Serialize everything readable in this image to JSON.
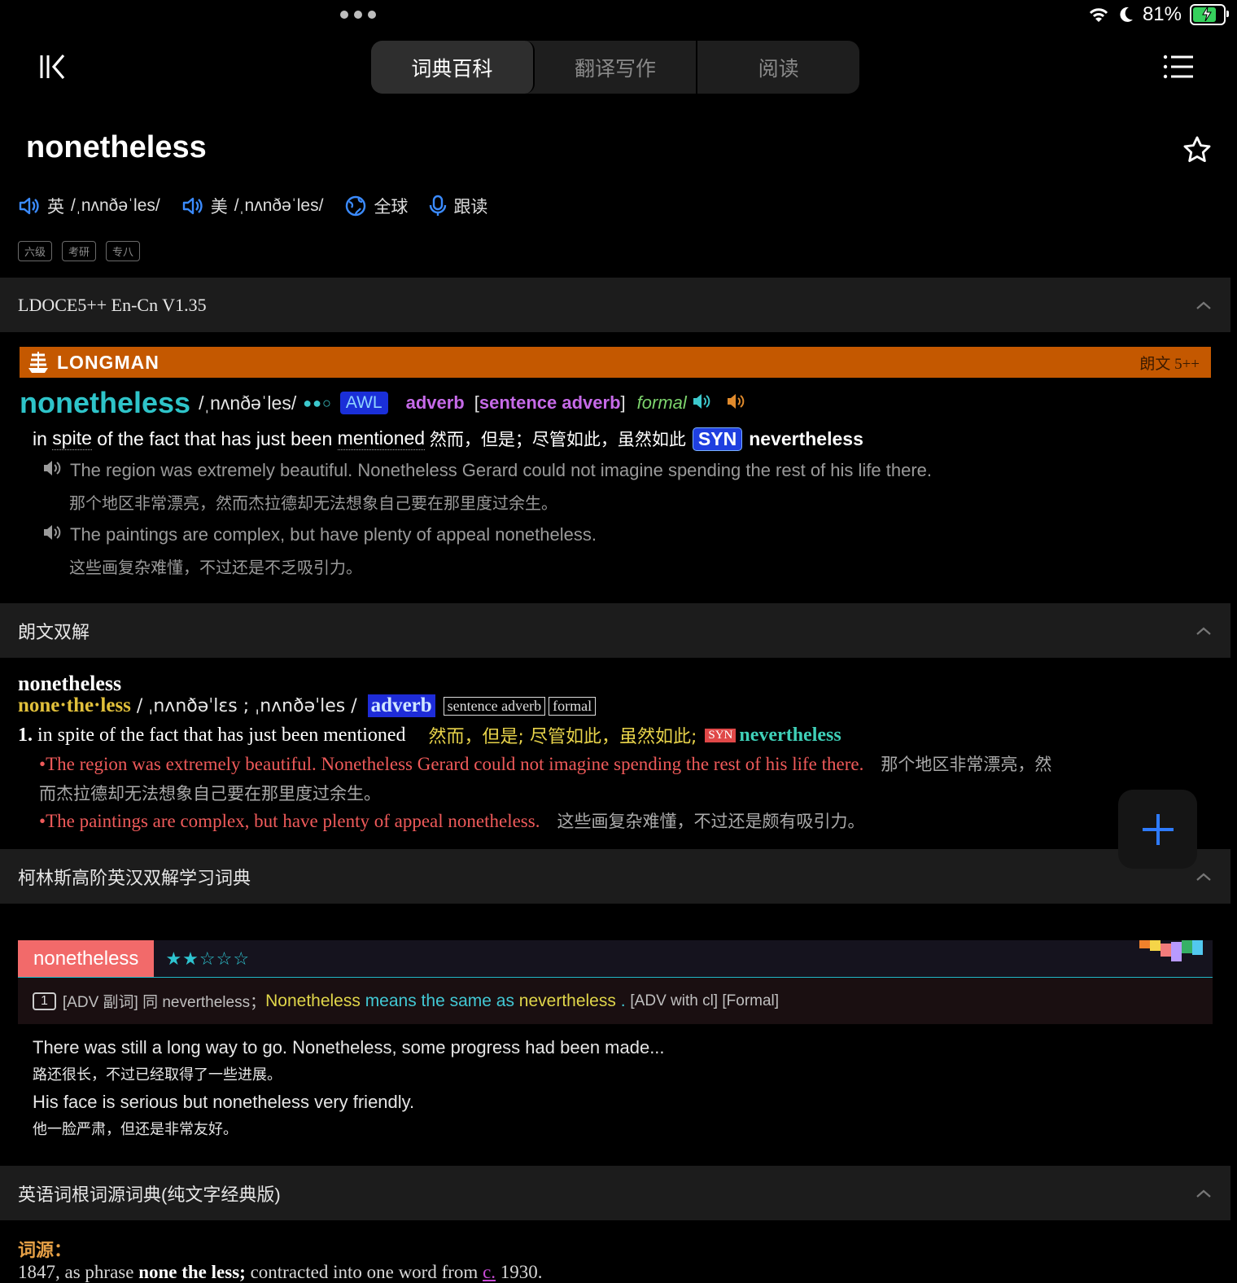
{
  "status": {
    "battery_text": "81%",
    "battery_level": 0.81
  },
  "nav": {
    "tabs": [
      {
        "label": "词典百科",
        "active": true
      },
      {
        "label": "翻译写作",
        "active": false
      },
      {
        "label": "阅读",
        "active": false
      }
    ]
  },
  "entry": {
    "headword": "nonetheless",
    "uk_label": "英",
    "uk_ipa": "/ˌnʌnðəˈles/",
    "us_label": "美",
    "us_ipa": "/ˌnʌnðəˈles/",
    "global_label": "全球",
    "follow_label": "跟读",
    "tags": [
      "六级",
      "考研",
      "专八"
    ]
  },
  "sections": {
    "ldoce": "LDOCE5++ En-Cn V1.35",
    "longman_dual": "朗文双解",
    "collins": "柯林斯高阶英汉双解学习词典",
    "etym": "英语词根词源词典(纯文字经典版)"
  },
  "longman": {
    "brand": "LONGMAN",
    "version": "朗文 5++",
    "word": "nonetheless",
    "ipa": "/ˌnʌnðəˈles/",
    "freq": "●●○",
    "awl": "AWL",
    "pos": "adverb",
    "bracket_open": "[",
    "pos_extra": "sentence adverb",
    "bracket_close": "]",
    "register": "formal",
    "def_pre": "in ",
    "def_w1": "spite",
    "def_mid": " of the fact that has just been ",
    "def_w2": "mentioned",
    "def_cn": " 然而，但是；尽管如此，虽然如此",
    "syn_label": "SYN",
    "syn_word": "nevertheless",
    "examples": [
      {
        "en": "The region was extremely beautiful. Nonetheless Gerard could not imagine spending the rest of his life there.",
        "cn": "那个地区非常漂亮，然而杰拉德却无法想象自己要在那里度过余生。"
      },
      {
        "en": "The paintings are complex, but have plenty of appeal nonetheless.",
        "cn": "这些画复杂难懂，不过还是不乏吸引力。"
      }
    ]
  },
  "longman_dual": {
    "word": "nonetheless",
    "hw": "none·the·less",
    "ipa": " / ˌnʌnðəˈlɛs ; ˌnʌnðəˈles / ",
    "pos": "adverb",
    "tag1": "sentence adverb",
    "tag2": "formal",
    "num": "1.",
    "def_en": " in spite of the fact that has just been mentioned ",
    "def_cn": "　然而，但是; 尽管如此，虽然如此;",
    "syn_label": "SYN",
    "syn_word": "nevertheless",
    "ex1_en": "The region was extremely beautiful. Nonetheless Gerard could not imagine spending the rest of his life there.",
    "ex1_cn_a": "　那个地区非常漂亮，然",
    "ex1_cn_b": "而杰拉德却无法想象自己要在那里度过余生。",
    "ex2_en": "The paintings are complex, but have plenty of appeal nonetheless.",
    "ex2_cn": "　这些画复杂难懂，不过还是颇有吸引力。",
    "bullet": "•"
  },
  "collins": {
    "word": "nonetheless",
    "stars": "★★☆☆☆",
    "rating": 2,
    "num": "1",
    "def_pre": "[ADV 副词] 同 nevertheless；",
    "def_y1": "Nonetheless",
    "def_c1": " means the same as ",
    "def_y2": "nevertheless",
    "def_c2": " . ",
    "def_post": "[ADV with cl] [Formal]",
    "examples": [
      {
        "en": "There was still a long way to go. Nonetheless, some progress had been made...",
        "cn": "路还很长，不过已经取得了一些进展。"
      },
      {
        "en": "His face is serious but nonetheless very friendly.",
        "cn": "他一脸严肃，但还是非常友好。"
      }
    ]
  },
  "etym": {
    "label": "词源：",
    "t1": "1847, as phrase ",
    "b1": "none the less;",
    "t2": " contracted into one word from ",
    "link": "c.",
    "t3": " 1930."
  },
  "colors": {
    "accent": "#2e7bff",
    "longman_orange": "#c45800",
    "collins_red": "#f26a6a",
    "teal": "#2ec4c9"
  }
}
